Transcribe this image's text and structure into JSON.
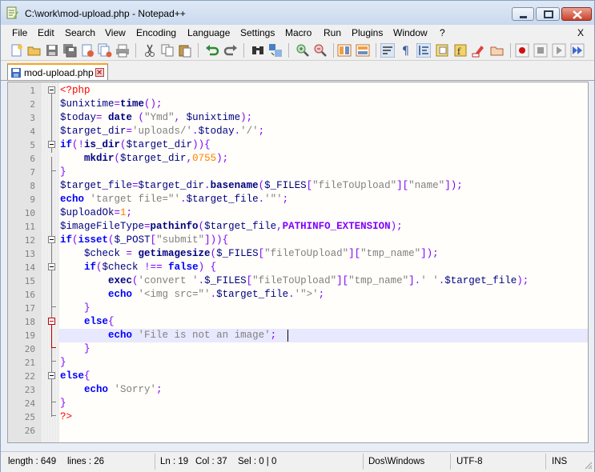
{
  "window": {
    "title": "C:\\work\\mod-upload.php - Notepad++"
  },
  "menu": {
    "items": [
      {
        "id": "file",
        "label": "File"
      },
      {
        "id": "edit",
        "label": "Edit"
      },
      {
        "id": "search",
        "label": "Search"
      },
      {
        "id": "view",
        "label": "View"
      },
      {
        "id": "encoding",
        "label": "Encoding"
      },
      {
        "id": "language",
        "label": "Language"
      },
      {
        "id": "settings",
        "label": "Settings"
      },
      {
        "id": "macro",
        "label": "Macro"
      },
      {
        "id": "run",
        "label": "Run"
      },
      {
        "id": "plugins",
        "label": "Plugins"
      },
      {
        "id": "window",
        "label": "Window"
      },
      {
        "id": "help",
        "label": "?"
      }
    ],
    "close_label": "X"
  },
  "tab": {
    "label": "mod-upload.php"
  },
  "editor": {
    "line_numbers": [
      "1",
      "2",
      "3",
      "4",
      "5",
      "6",
      "7",
      "8",
      "9",
      "10",
      "11",
      "12",
      "13",
      "14",
      "15",
      "16",
      "17",
      "18",
      "19",
      "20",
      "21",
      "22",
      "23",
      "24",
      "25",
      "26"
    ],
    "current_line": 19,
    "lines": [
      [
        {
          "t": "<?php",
          "c": "pt"
        }
      ],
      [
        {
          "t": "$unixtime",
          "c": "v"
        },
        {
          "t": "=",
          "c": "o"
        },
        {
          "t": "time",
          "c": "fnc"
        },
        {
          "t": "();",
          "c": "o"
        }
      ],
      [
        {
          "t": "$today",
          "c": "v"
        },
        {
          "t": "= ",
          "c": "o"
        },
        {
          "t": "date",
          "c": "fnc"
        },
        {
          "t": " (",
          "c": "o"
        },
        {
          "t": "\"Ymd\"",
          "c": "s"
        },
        {
          "t": ", ",
          "c": "o"
        },
        {
          "t": "$unixtime",
          "c": "v"
        },
        {
          "t": ");",
          "c": "o"
        }
      ],
      [
        {
          "t": "$target_dir",
          "c": "v"
        },
        {
          "t": "=",
          "c": "o"
        },
        {
          "t": "'uploads/'",
          "c": "s"
        },
        {
          "t": ".",
          "c": "o"
        },
        {
          "t": "$today",
          "c": "v"
        },
        {
          "t": ".",
          "c": "o"
        },
        {
          "t": "'/'",
          "c": "s"
        },
        {
          "t": ";",
          "c": "o"
        }
      ],
      [
        {
          "t": "if",
          "c": "k"
        },
        {
          "t": "(!",
          "c": "o"
        },
        {
          "t": "is_dir",
          "c": "fnc"
        },
        {
          "t": "(",
          "c": "o"
        },
        {
          "t": "$target_dir",
          "c": "v"
        },
        {
          "t": ")){",
          "c": "o"
        }
      ],
      [
        {
          "t": "    ",
          "c": "v"
        },
        {
          "t": "mkdir",
          "c": "fnc"
        },
        {
          "t": "(",
          "c": "o"
        },
        {
          "t": "$target_dir",
          "c": "v"
        },
        {
          "t": ",",
          "c": "o"
        },
        {
          "t": "0755",
          "c": "n"
        },
        {
          "t": ");",
          "c": "o"
        }
      ],
      [
        {
          "t": "}",
          "c": "o"
        }
      ],
      [
        {
          "t": "$target_file",
          "c": "v"
        },
        {
          "t": "=",
          "c": "o"
        },
        {
          "t": "$target_dir",
          "c": "v"
        },
        {
          "t": ".",
          "c": "o"
        },
        {
          "t": "basename",
          "c": "fnc"
        },
        {
          "t": "(",
          "c": "o"
        },
        {
          "t": "$_FILES",
          "c": "v"
        },
        {
          "t": "[",
          "c": "o"
        },
        {
          "t": "\"fileToUpload\"",
          "c": "s"
        },
        {
          "t": "][",
          "c": "o"
        },
        {
          "t": "\"name\"",
          "c": "s"
        },
        {
          "t": "]);",
          "c": "o"
        }
      ],
      [
        {
          "t": "echo",
          "c": "k"
        },
        {
          "t": " ",
          "c": "v"
        },
        {
          "t": "'target file=\"'",
          "c": "s"
        },
        {
          "t": ".",
          "c": "o"
        },
        {
          "t": "$target_file",
          "c": "v"
        },
        {
          "t": ".",
          "c": "o"
        },
        {
          "t": "'\"'",
          "c": "s"
        },
        {
          "t": ";",
          "c": "o"
        }
      ],
      [
        {
          "t": "$uploadOk",
          "c": "v"
        },
        {
          "t": "=",
          "c": "o"
        },
        {
          "t": "1",
          "c": "n"
        },
        {
          "t": ";",
          "c": "o"
        }
      ],
      [
        {
          "t": "$imageFileType",
          "c": "v"
        },
        {
          "t": "=",
          "c": "o"
        },
        {
          "t": "pathinfo",
          "c": "fnc"
        },
        {
          "t": "(",
          "c": "o"
        },
        {
          "t": "$target_file",
          "c": "v"
        },
        {
          "t": ",",
          "c": "o"
        },
        {
          "t": "PATHINFO_EXTENSION",
          "c": "cst"
        },
        {
          "t": ");",
          "c": "o"
        }
      ],
      [
        {
          "t": "if",
          "c": "k"
        },
        {
          "t": "(",
          "c": "o"
        },
        {
          "t": "isset",
          "c": "k"
        },
        {
          "t": "(",
          "c": "o"
        },
        {
          "t": "$_POST",
          "c": "v"
        },
        {
          "t": "[",
          "c": "o"
        },
        {
          "t": "\"submit\"",
          "c": "s"
        },
        {
          "t": "])){",
          "c": "o"
        }
      ],
      [
        {
          "t": "    ",
          "c": "v"
        },
        {
          "t": "$check",
          "c": "v"
        },
        {
          "t": " = ",
          "c": "o"
        },
        {
          "t": "getimagesize",
          "c": "fnc"
        },
        {
          "t": "(",
          "c": "o"
        },
        {
          "t": "$_FILES",
          "c": "v"
        },
        {
          "t": "[",
          "c": "o"
        },
        {
          "t": "\"fileToUpload\"",
          "c": "s"
        },
        {
          "t": "][",
          "c": "o"
        },
        {
          "t": "\"tmp_name\"",
          "c": "s"
        },
        {
          "t": "]);",
          "c": "o"
        }
      ],
      [
        {
          "t": "    ",
          "c": "v"
        },
        {
          "t": "if",
          "c": "k"
        },
        {
          "t": "(",
          "c": "o"
        },
        {
          "t": "$check",
          "c": "v"
        },
        {
          "t": " !== ",
          "c": "o"
        },
        {
          "t": "false",
          "c": "k"
        },
        {
          "t": ") {",
          "c": "o"
        }
      ],
      [
        {
          "t": "        ",
          "c": "v"
        },
        {
          "t": "exec",
          "c": "fnc"
        },
        {
          "t": "(",
          "c": "o"
        },
        {
          "t": "'convert '",
          "c": "s"
        },
        {
          "t": ".",
          "c": "o"
        },
        {
          "t": "$_FILES",
          "c": "v"
        },
        {
          "t": "[",
          "c": "o"
        },
        {
          "t": "\"fileToUpload\"",
          "c": "s"
        },
        {
          "t": "][",
          "c": "o"
        },
        {
          "t": "\"tmp_name\"",
          "c": "s"
        },
        {
          "t": "].",
          "c": "o"
        },
        {
          "t": "' '",
          "c": "s"
        },
        {
          "t": ".",
          "c": "o"
        },
        {
          "t": "$target_file",
          "c": "v"
        },
        {
          "t": ");",
          "c": "o"
        }
      ],
      [
        {
          "t": "        ",
          "c": "v"
        },
        {
          "t": "echo",
          "c": "k"
        },
        {
          "t": " ",
          "c": "v"
        },
        {
          "t": "'<img src=\"'",
          "c": "s"
        },
        {
          "t": ".",
          "c": "o"
        },
        {
          "t": "$target_file",
          "c": "v"
        },
        {
          "t": ".",
          "c": "o"
        },
        {
          "t": "'\">'",
          "c": "s"
        },
        {
          "t": ";",
          "c": "o"
        }
      ],
      [
        {
          "t": "    ",
          "c": "v"
        },
        {
          "t": "}",
          "c": "o"
        }
      ],
      [
        {
          "t": "    ",
          "c": "v"
        },
        {
          "t": "else",
          "c": "k"
        },
        {
          "t": "{",
          "c": "o"
        }
      ],
      [
        {
          "t": "        ",
          "c": "v"
        },
        {
          "t": "echo",
          "c": "k"
        },
        {
          "t": " ",
          "c": "v"
        },
        {
          "t": "'File is not an image'",
          "c": "s"
        },
        {
          "t": ";",
          "c": "o"
        }
      ],
      [
        {
          "t": "    ",
          "c": "v"
        },
        {
          "t": "}",
          "c": "o"
        }
      ],
      [
        {
          "t": "}",
          "c": "o"
        }
      ],
      [
        {
          "t": "else",
          "c": "k"
        },
        {
          "t": "{",
          "c": "o"
        }
      ],
      [
        {
          "t": "    ",
          "c": "v"
        },
        {
          "t": "echo",
          "c": "k"
        },
        {
          "t": " ",
          "c": "v"
        },
        {
          "t": "'Sorry'",
          "c": "s"
        },
        {
          "t": ";",
          "c": "o"
        }
      ],
      [
        {
          "t": "}",
          "c": "o"
        }
      ],
      [
        {
          "t": "?>",
          "c": "pt"
        }
      ],
      []
    ]
  },
  "status": {
    "length": "length : 649",
    "lines": "lines : 26",
    "ln": "Ln : 19",
    "col": "Col : 37",
    "sel": "Sel : 0 | 0",
    "eol": "Dos\\Windows",
    "encoding": "UTF-8",
    "mode": "INS"
  },
  "toolbar": {
    "icons": [
      "new-file-icon",
      "open-file-icon",
      "save-icon",
      "save-all-icon",
      "close-icon",
      "close-all-icon",
      "print-icon",
      "cut-icon",
      "copy-icon",
      "paste-icon",
      "undo-icon",
      "redo-icon",
      "find-icon",
      "replace-icon",
      "zoom-in-icon",
      "zoom-out-icon",
      "sync-vertical-icon",
      "sync-horizontal-icon",
      "word-wrap-icon",
      "show-all-chars-icon",
      "indent-guide-icon",
      "document-map-icon",
      "function-list-icon",
      "folder-workspace-icon",
      "monitoring-icon",
      "record-macro-icon",
      "stop-record-icon",
      "play-macro-icon",
      "run-macro-multiple-icon"
    ]
  },
  "colors": {
    "accent_tab": "#f5a623",
    "keyword": "#0000ff",
    "string": "#808080",
    "number": "#ff8000",
    "operator": "#8000ff",
    "php_tag": "#ff0000",
    "current_line": "#e8e8ff"
  }
}
